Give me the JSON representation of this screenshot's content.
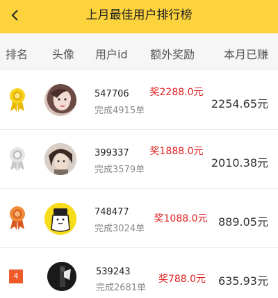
{
  "header": {
    "title": "上月最佳用户排行榜",
    "back_icon": "chevron-left-icon"
  },
  "columns": {
    "rank": "排名",
    "avatar": "头像",
    "uid": "用户id",
    "bonus": "额外奖励",
    "earned": "本月已赚"
  },
  "colors": {
    "accent": "#fcd33d",
    "bonus": "#e02020",
    "rank4": "#ef5a2a"
  },
  "rows": [
    {
      "rank_icon": "gold-medal-icon",
      "uid": "547706",
      "done": "完成4915单",
      "bonus": "奖2288.0元",
      "earned": "2254.65元"
    },
    {
      "rank_icon": "silver-medal-icon",
      "uid": "399337",
      "done": "完成3579单",
      "bonus": "奖1888.0元",
      "earned": "2010.38元"
    },
    {
      "rank_icon": "bronze-medal-icon",
      "uid": "748477",
      "done": "完成3024单",
      "bonus": "奖1088.0元",
      "earned": "889.05元"
    },
    {
      "rank_label": "4",
      "uid": "539243",
      "done": "完成2681单",
      "bonus": "奖788.0元",
      "earned": "635.93元"
    }
  ]
}
